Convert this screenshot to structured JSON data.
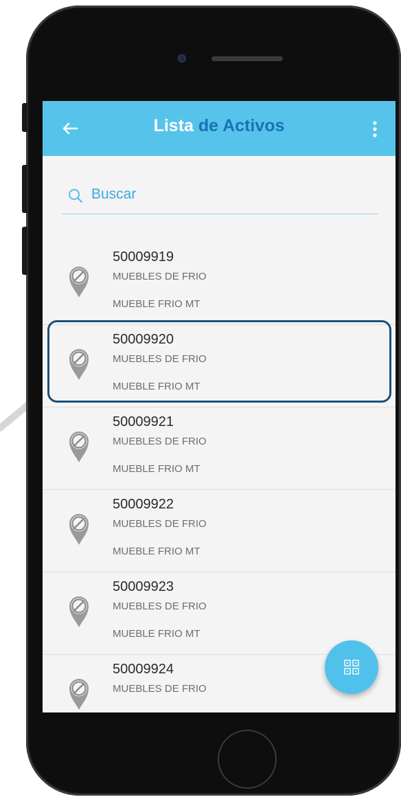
{
  "header": {
    "title_part1": "Lista",
    "title_part2": "de Activos",
    "back_icon": "arrow-left-icon",
    "menu_icon": "more-vertical-icon"
  },
  "search": {
    "placeholder": "Buscar",
    "icon": "search-icon"
  },
  "assets": [
    {
      "code": "50009919",
      "category": "MUEBLES DE FRIO",
      "type": "MUEBLE FRIO MT"
    },
    {
      "code": "50009920",
      "category": "MUEBLES DE FRIO",
      "type": "MUEBLE FRIO MT"
    },
    {
      "code": "50009921",
      "category": "MUEBLES DE FRIO",
      "type": "MUEBLE FRIO MT"
    },
    {
      "code": "50009922",
      "category": "MUEBLES DE FRIO",
      "type": "MUEBLE FRIO MT"
    },
    {
      "code": "50009923",
      "category": "MUEBLES DE FRIO",
      "type": "MUEBLE FRIO MT"
    },
    {
      "code": "50009924",
      "category": "MUEBLES DE FRIO",
      "type": ""
    }
  ],
  "fab": {
    "icon": "qr-code-icon"
  },
  "colors": {
    "appbar": "#56c4ea",
    "title_accent": "#1b70b8",
    "highlight_border": "#1c4f7a",
    "fab": "#50c1ea"
  }
}
